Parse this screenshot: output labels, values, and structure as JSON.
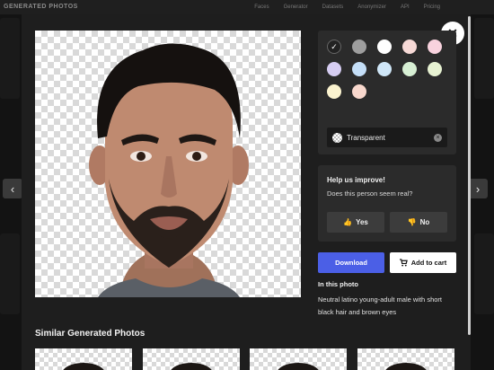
{
  "background_page": {
    "logo": "GENERATED PHOTOS",
    "nav": [
      "Faces",
      "Generator",
      "Datasets",
      "Anonymizer",
      "API",
      "Pricing"
    ]
  },
  "modal": {
    "close_icon": "close-icon",
    "color_swatches": [
      "#1e1e1e",
      "#9e9e9e",
      "#ffffff",
      "#f6d9d6",
      "#f8d2de",
      "#d6cdf2",
      "#c4def7",
      "#cfe6f7",
      "#d7efd4",
      "#e7f2d2",
      "#fbf3cf",
      "#f8d8cd"
    ],
    "background_select": {
      "label": "Transparent"
    },
    "feedback": {
      "title": "Help us improve!",
      "question": "Does this person seem real?",
      "yes_label": "Yes",
      "no_label": "No",
      "yes_icon": "👍",
      "no_icon": "👎"
    },
    "download_label": "Download",
    "add_to_cart_label": "Add to cart",
    "in_photo_title": "In this photo",
    "in_photo_description": "Neutral latino young-adult male with short black hair and brown eyes",
    "similar_title": "Similar Generated Photos"
  },
  "nav_prev_icon": "‹",
  "nav_next_icon": "›",
  "colors": {
    "accent": "#4b5fe6",
    "modal_bg": "#1e1e1e",
    "panel_bg": "#2b2b2b"
  }
}
